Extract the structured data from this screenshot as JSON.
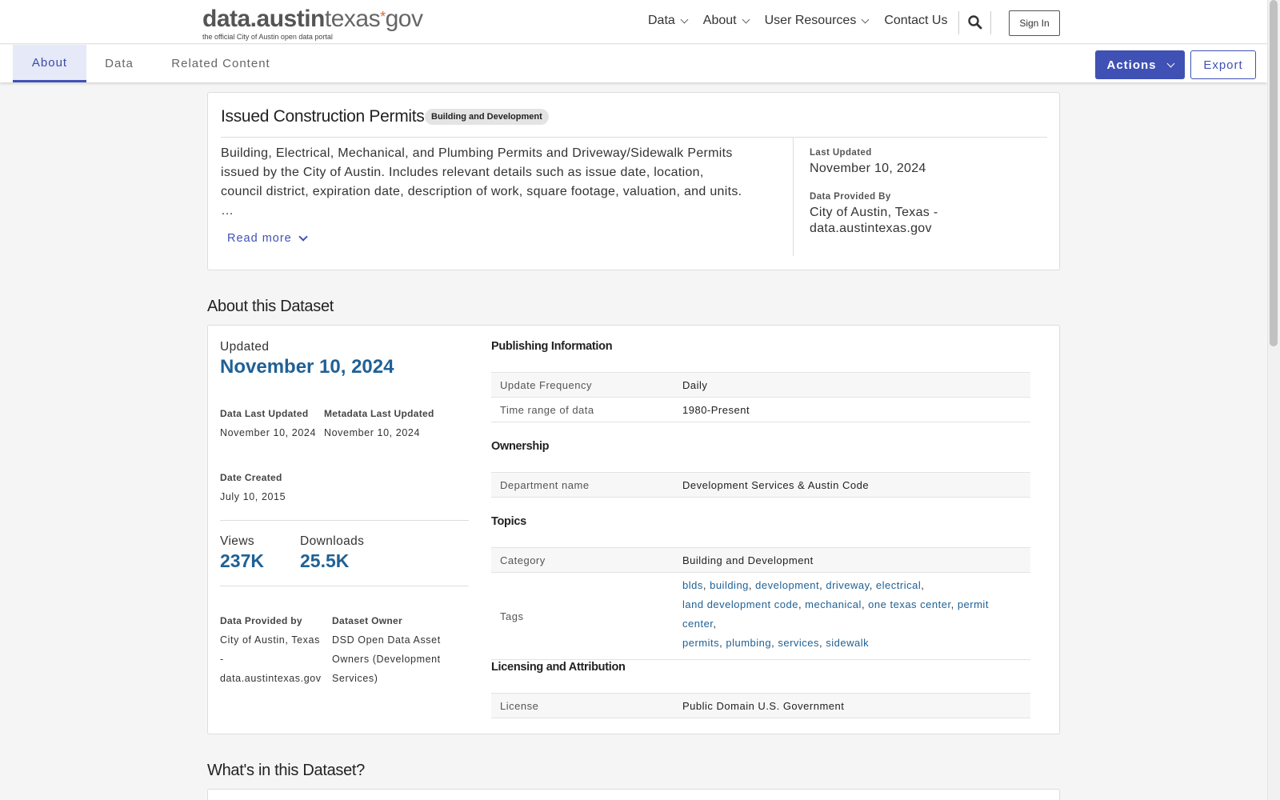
{
  "header": {
    "logo_main_bold": "data.austin",
    "logo_main_rest": "texas",
    "logo_star": "*",
    "logo_gov": "gov",
    "logo_sub": "the official City of Austin open data portal",
    "nav": [
      "Data",
      "About",
      "User Resources",
      "Contact Us"
    ],
    "sign_in": "Sign In",
    "search_icon": "search-icon"
  },
  "tabs": [
    {
      "label": "About",
      "active": true
    },
    {
      "label": "Data",
      "active": false
    },
    {
      "label": "Related Content",
      "active": false
    }
  ],
  "toolbar": {
    "actions": "Actions",
    "export": "Export"
  },
  "dataset": {
    "title": "Issued Construction Permits",
    "category_badge": "Building and Development",
    "description_lines": [
      "Building, Electrical, Mechanical, and Plumbing Permits and Driveway/Sidewalk Permits",
      "issued by the City of Austin. Includes relevant details such as issue date, location,",
      "council district, expiration date, description of work, square footage, valuation, and units.",
      "…"
    ],
    "read_more": "Read more",
    "last_updated_label": "Last Updated",
    "last_updated": "November 10, 2024",
    "provided_by_label": "Data Provided By",
    "provided_by_lines": [
      "City of Austin, Texas -",
      "data.austintexas.gov"
    ]
  },
  "about": {
    "heading": "About this Dataset",
    "updated_label": "Updated",
    "updated": "November 10, 2024",
    "data_last_updated_label": "Data Last Updated",
    "data_last_updated": "November 10, 2024",
    "metadata_last_updated_label": "Metadata Last Updated",
    "metadata_last_updated": "November 10, 2024",
    "date_created_label": "Date Created",
    "date_created": "July 10, 2015",
    "views_label": "Views",
    "views": "237K",
    "downloads_label": "Downloads",
    "downloads": "25.5K",
    "provided_by_label": "Data Provided by",
    "provided_by_lines": [
      "City of Austin, Texas",
      "-",
      "data.austintexas.gov"
    ],
    "owner_label": "Dataset Owner",
    "owner_lines": [
      "DSD Open Data Asset",
      "Owners (Development",
      "Services)"
    ],
    "publishing": {
      "heading": "Publishing Information",
      "rows": [
        {
          "key": "Update Frequency",
          "value": "Daily"
        },
        {
          "key": "Time range of data",
          "value": "1980-Present"
        }
      ]
    },
    "ownership": {
      "heading": "Ownership",
      "rows": [
        {
          "key": "Department name",
          "value": "Development Services & Austin Code"
        }
      ]
    },
    "topics": {
      "heading": "Topics",
      "category_key": "Category",
      "category_value": "Building and Development",
      "tags_key": "Tags",
      "tags": [
        "blds",
        "building",
        "development",
        "driveway",
        "electrical",
        "land development code",
        "mechanical",
        "one texas center",
        "permit center",
        "permits",
        "plumbing",
        "services",
        "sidewalk"
      ]
    },
    "licensing": {
      "heading": "Licensing and Attribution",
      "license_key": "License",
      "license_value": "Public Domain U.S. Government"
    }
  },
  "whats_in": {
    "heading": "What's in this Dataset?"
  },
  "colors": {
    "accent": "#3f51b5",
    "link": "#1f6196",
    "tab_active_bg": "#e6e9f7"
  }
}
